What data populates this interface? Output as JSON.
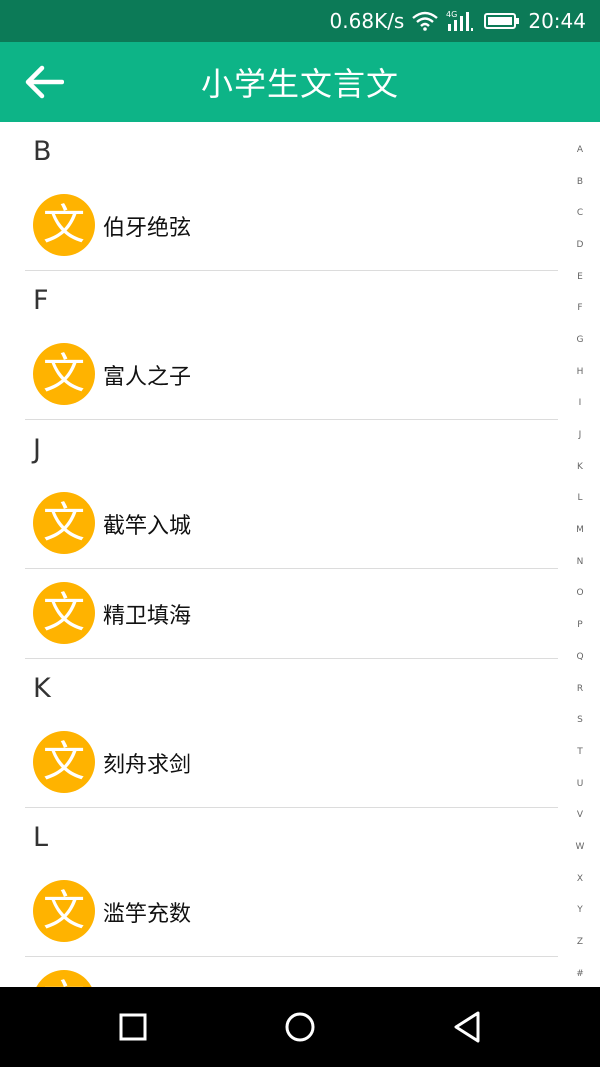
{
  "status_bar": {
    "network_speed": "0.68K/s",
    "network_type": "4G",
    "time": "20:44"
  },
  "app_bar": {
    "title": "小学生文言文"
  },
  "colors": {
    "status_bar": "#0c7a57",
    "app_bar": "#0db487",
    "avatar": "#ffb300",
    "divider": "#dcdcdc"
  },
  "avatar_glyph": "文",
  "sections": [
    {
      "letter": "B",
      "items": [
        "伯牙绝弦"
      ]
    },
    {
      "letter": "F",
      "items": [
        "富人之子"
      ]
    },
    {
      "letter": "J",
      "items": [
        "截竿入城",
        "精卫填海"
      ]
    },
    {
      "letter": "K",
      "items": [
        "刻舟求剑"
      ]
    },
    {
      "letter": "L",
      "items": [
        "滥竽充数",
        ""
      ]
    }
  ],
  "index_letters": [
    "A",
    "B",
    "C",
    "D",
    "E",
    "F",
    "G",
    "H",
    "I",
    "J",
    "K",
    "L",
    "M",
    "N",
    "O",
    "P",
    "Q",
    "R",
    "S",
    "T",
    "U",
    "V",
    "W",
    "X",
    "Y",
    "Z",
    "#"
  ],
  "icons": [
    "wifi-icon",
    "signal-icon",
    "battery-icon",
    "back-arrow-icon",
    "recent-apps-icon",
    "home-icon",
    "back-triangle-icon"
  ]
}
